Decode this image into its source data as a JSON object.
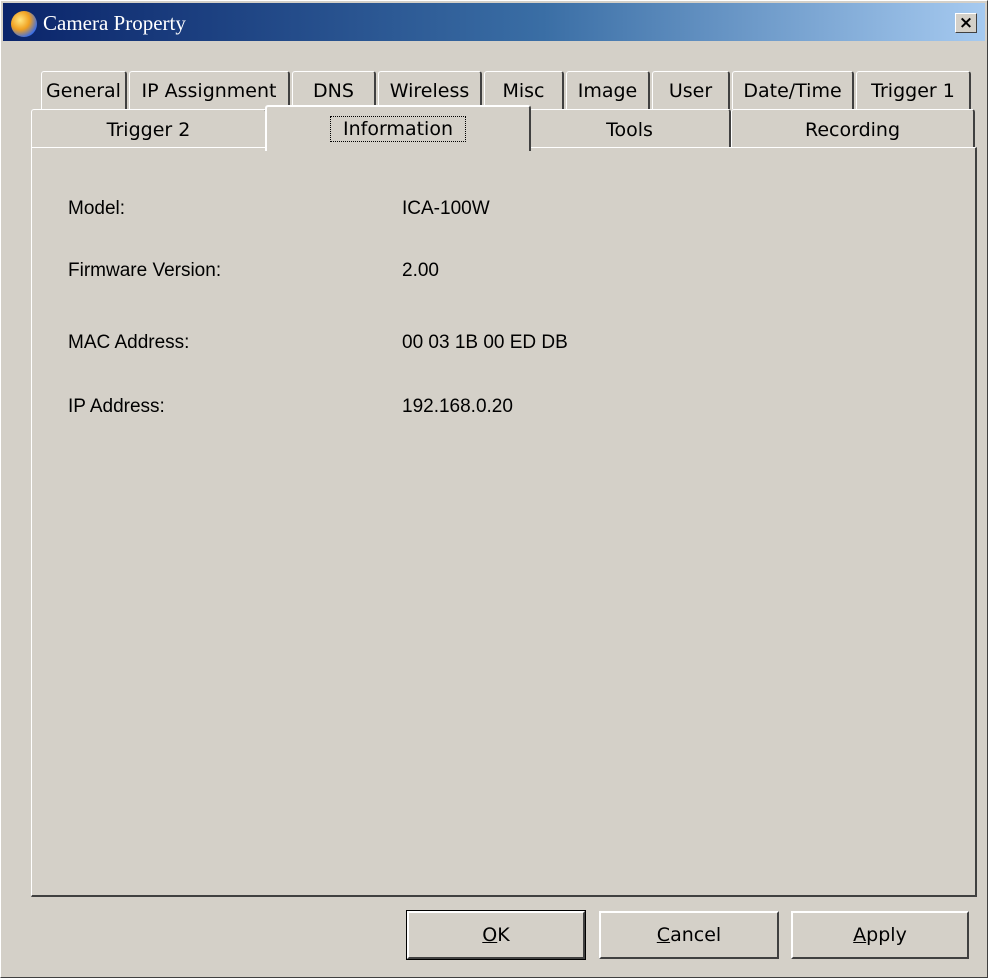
{
  "window": {
    "title": "Camera Property",
    "close_glyph": "×"
  },
  "tabs": {
    "row1": [
      "General",
      "IP Assignment",
      "DNS",
      "Wireless",
      "Misc",
      "Image",
      "User",
      "Date/Time",
      "Trigger 1"
    ],
    "row2": [
      "Trigger 2",
      "Information",
      "Tools",
      "Recording"
    ],
    "active": "Information"
  },
  "info": {
    "model_label": "Model:",
    "model_value": "ICA-100W",
    "firmware_label": "Firmware Version:",
    "firmware_value": "2.00",
    "mac_label": "MAC Address:",
    "mac_value": "00 03 1B 00 ED DB",
    "ip_label": "IP Address:",
    "ip_value": "192.168.0.20"
  },
  "buttons": {
    "ok_mnemonic": "O",
    "ok_rest": "K",
    "cancel_mnemonic": "C",
    "cancel_rest": "ancel",
    "apply_mnemonic": "A",
    "apply_rest": "pply"
  }
}
